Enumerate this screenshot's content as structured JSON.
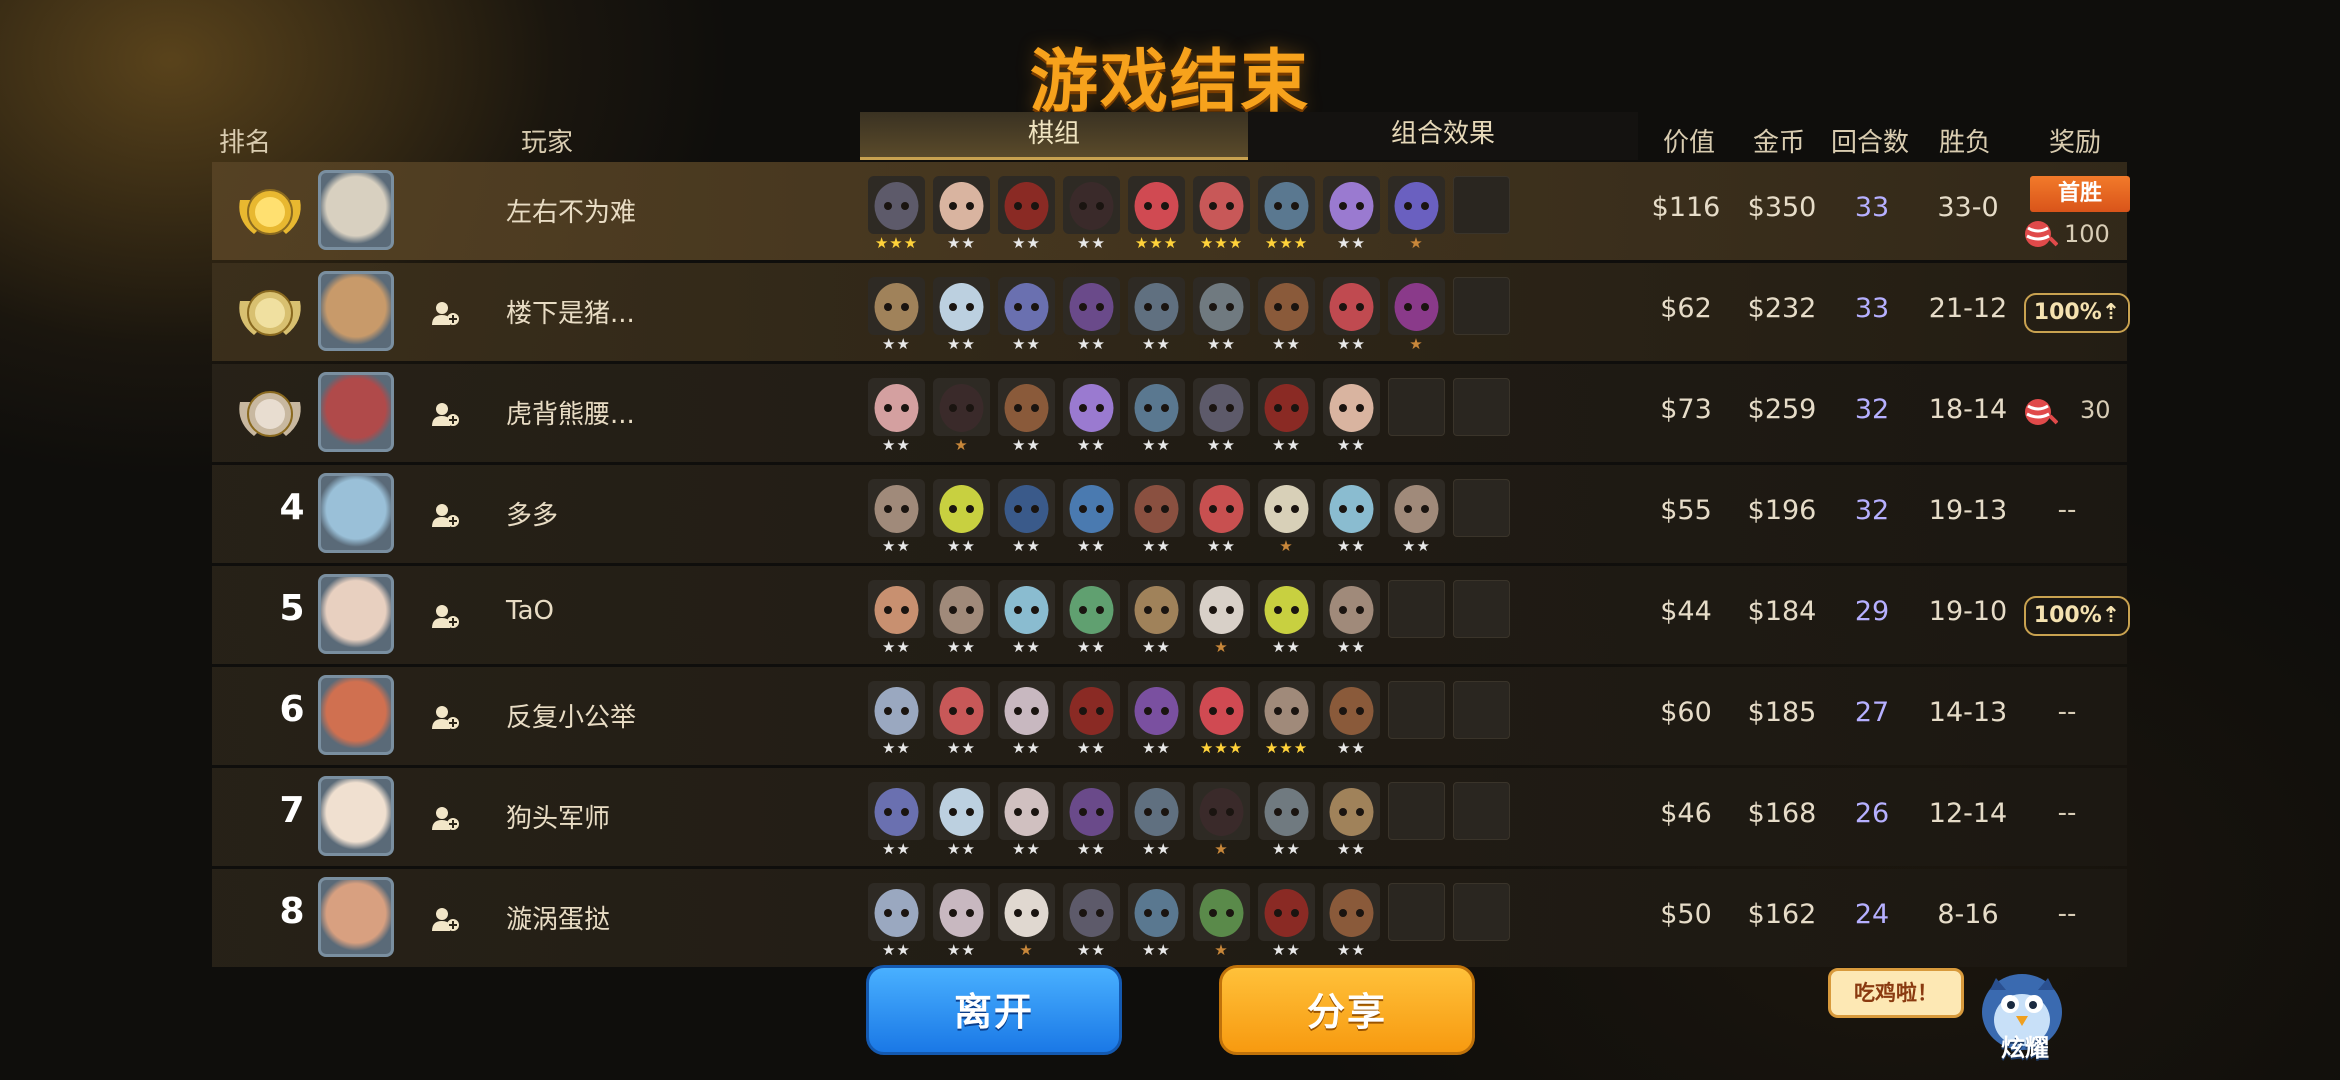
{
  "title": "游戏结束",
  "headers": {
    "rank": "排名",
    "player": "玩家",
    "lineup": "棋组",
    "combo": "组合效果",
    "value": "价值",
    "gold": "金币",
    "rounds": "回合数",
    "winloss": "胜负",
    "reward": "奖励"
  },
  "colors": {
    "star_gold": "#ffd23a",
    "star_silver": "#e8e8e8",
    "star_bronze": "#c8873a",
    "accent_orange": "#f7a21c",
    "rounds_color": "#b6b0ff"
  },
  "players": [
    {
      "rank": "1",
      "medal": "gold",
      "name": "左右不为难",
      "avatar_color": "#d8d0c0",
      "value": "$116",
      "gold": "$350",
      "rounds": "33",
      "winloss": "33-0",
      "reward_type": "firstwin",
      "reward_label": "首胜",
      "reward_amount": "100",
      "units": [
        {
          "c": "#5d5a6a",
          "s": 3
        },
        {
          "c": "#d9b4a0",
          "s": 2
        },
        {
          "c": "#8a2a24",
          "s": 2
        },
        {
          "c": "#3a2a2a",
          "s": 2
        },
        {
          "c": "#d04a52",
          "s": 3
        },
        {
          "c": "#c85858",
          "s": 3
        },
        {
          "c": "#5a7890",
          "s": 3
        },
        {
          "c": "#9a7ad0",
          "s": 2
        },
        {
          "c": "#6a60c0",
          "s": 1
        }
      ]
    },
    {
      "rank": "2",
      "medal": "silver",
      "name": "楼下是猪...",
      "avatar_color": "#c89a6a",
      "value": "$62",
      "gold": "$232",
      "rounds": "33",
      "winloss": "21-12",
      "reward_type": "badge",
      "reward_label": "100%",
      "units": [
        {
          "c": "#a0825a",
          "s": 2
        },
        {
          "c": "#bcd0e0",
          "s": 2
        },
        {
          "c": "#6a70b0",
          "s": 2
        },
        {
          "c": "#6a4a8a",
          "s": 2
        },
        {
          "c": "#607080",
          "s": 2
        },
        {
          "c": "#707a80",
          "s": 2
        },
        {
          "c": "#8a5a3a",
          "s": 2
        },
        {
          "c": "#c04a50",
          "s": 2
        },
        {
          "c": "#8a3a8a",
          "s": 1
        }
      ]
    },
    {
      "rank": "3",
      "medal": "bronze",
      "name": "虎背熊腰...",
      "avatar_color": "#b04a4a",
      "value": "$73",
      "gold": "$259",
      "rounds": "32",
      "winloss": "18-14",
      "reward_type": "candy",
      "reward_amount": "30",
      "units": [
        {
          "c": "#d4a0a0",
          "s": 2
        },
        {
          "c": "#3a2a2a",
          "s": 1
        },
        {
          "c": "#8a5a3a",
          "s": 2
        },
        {
          "c": "#9a7ad0",
          "s": 2
        },
        {
          "c": "#5a7890",
          "s": 2
        },
        {
          "c": "#5d5a6a",
          "s": 2
        },
        {
          "c": "#8a2a24",
          "s": 2
        },
        {
          "c": "#d9b4a0",
          "s": 2
        }
      ]
    },
    {
      "rank": "4",
      "medal": "",
      "name": "多多",
      "avatar_color": "#9ac0d8",
      "value": "$55",
      "gold": "$196",
      "rounds": "32",
      "winloss": "19-13",
      "reward_type": "none",
      "reward_label": "--",
      "units": [
        {
          "c": "#a08a7a",
          "s": 2
        },
        {
          "c": "#c8d040",
          "s": 2
        },
        {
          "c": "#3a5a8a",
          "s": 2
        },
        {
          "c": "#4a7ab0",
          "s": 2
        },
        {
          "c": "#8a5040",
          "s": 2
        },
        {
          "c": "#c85050",
          "s": 2
        },
        {
          "c": "#d8d0b8",
          "s": 1
        },
        {
          "c": "#8abcd0",
          "s": 2
        },
        {
          "c": "#a08a7a",
          "s": 2
        }
      ]
    },
    {
      "rank": "5",
      "medal": "",
      "name": "TaO",
      "avatar_color": "#e8d0c0",
      "value": "$44",
      "gold": "$184",
      "rounds": "29",
      "winloss": "19-10",
      "reward_type": "badge",
      "reward_label": "100%",
      "units": [
        {
          "c": "#c89070",
          "s": 2
        },
        {
          "c": "#a08a7a",
          "s": 2
        },
        {
          "c": "#8abcd0",
          "s": 2
        },
        {
          "c": "#60a070",
          "s": 2
        },
        {
          "c": "#a0825a",
          "s": 2
        },
        {
          "c": "#d8d0c8",
          "s": 1
        },
        {
          "c": "#c8d040",
          "s": 2
        },
        {
          "c": "#a08a7a",
          "s": 2
        }
      ]
    },
    {
      "rank": "6",
      "medal": "",
      "name": "反复小公举",
      "avatar_color": "#d07050",
      "value": "$60",
      "gold": "$185",
      "rounds": "27",
      "winloss": "14-13",
      "reward_type": "none",
      "reward_label": "--",
      "units": [
        {
          "c": "#9aa8c0",
          "s": 2
        },
        {
          "c": "#c85858",
          "s": 2
        },
        {
          "c": "#c8b8c0",
          "s": 2
        },
        {
          "c": "#8a2a24",
          "s": 2
        },
        {
          "c": "#7a50a0",
          "s": 2
        },
        {
          "c": "#d04a52",
          "s": 3
        },
        {
          "c": "#a08a7a",
          "s": 3
        },
        {
          "c": "#8a5a3a",
          "s": 2
        }
      ]
    },
    {
      "rank": "7",
      "medal": "",
      "name": "狗头军师",
      "avatar_color": "#f0e0d0",
      "value": "$46",
      "gold": "$168",
      "rounds": "26",
      "winloss": "12-14",
      "reward_type": "none",
      "reward_label": "--",
      "units": [
        {
          "c": "#6a70b0",
          "s": 2
        },
        {
          "c": "#bcd0e0",
          "s": 2
        },
        {
          "c": "#d0c0c0",
          "s": 2
        },
        {
          "c": "#6a4a8a",
          "s": 2
        },
        {
          "c": "#607080",
          "s": 2
        },
        {
          "c": "#3a2a2a",
          "s": 1
        },
        {
          "c": "#707a80",
          "s": 2
        },
        {
          "c": "#a0825a",
          "s": 2
        }
      ]
    },
    {
      "rank": "8",
      "medal": "",
      "name": "漩涡蛋挞",
      "avatar_color": "#d8a080",
      "value": "$50",
      "gold": "$162",
      "rounds": "24",
      "winloss": "8-16",
      "reward_type": "none",
      "reward_label": "--",
      "units": [
        {
          "c": "#9aa8c0",
          "s": 2
        },
        {
          "c": "#c8b8c0",
          "s": 2
        },
        {
          "c": "#e0d8d0",
          "s": 1
        },
        {
          "c": "#5d5a6a",
          "s": 2
        },
        {
          "c": "#5a7890",
          "s": 2
        },
        {
          "c": "#5a8a4a",
          "s": 1
        },
        {
          "c": "#8a2a24",
          "s": 2
        },
        {
          "c": "#8a5a3a",
          "s": 2
        }
      ]
    }
  ],
  "buttons": {
    "leave": "离开",
    "share": "分享"
  },
  "bubble_text": "吃鸡啦！",
  "mascot_label": "炫耀"
}
